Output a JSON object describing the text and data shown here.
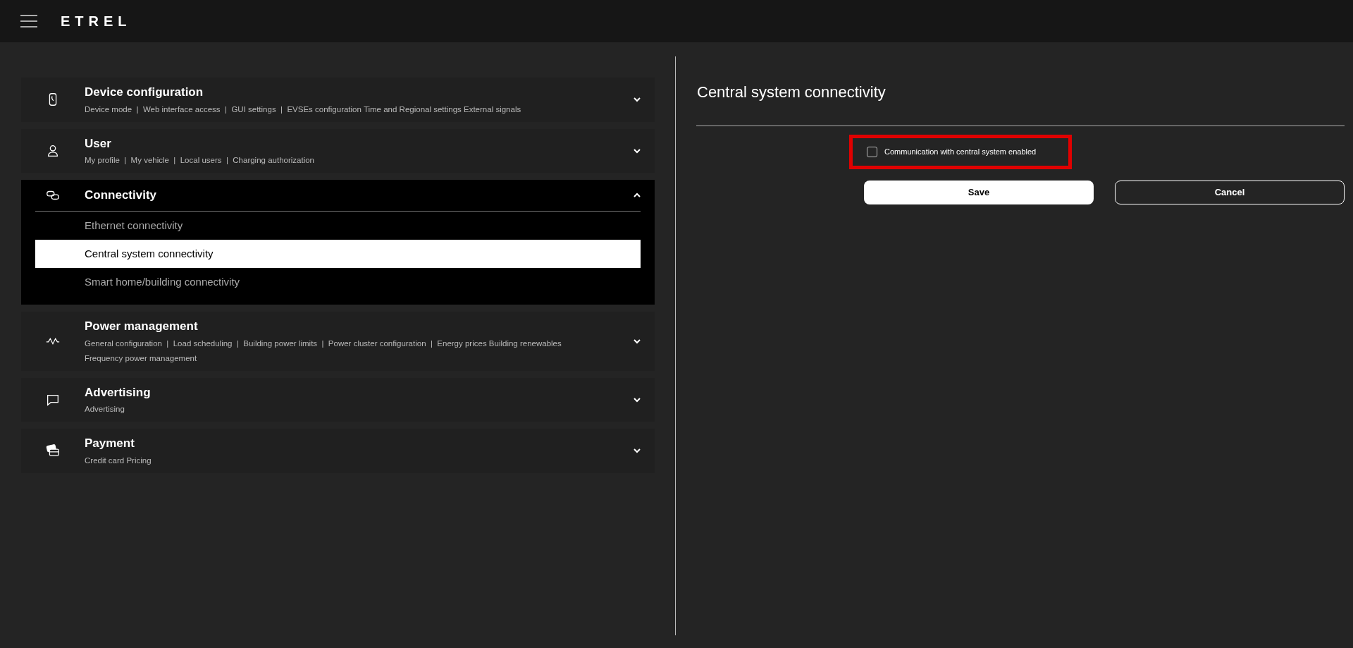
{
  "header": {
    "logo": "ETREL"
  },
  "sections": [
    {
      "title": "Device configuration",
      "expanded": false,
      "lines": [
        "Device mode  |  Web interface access  |  GUI settings  |  EVSEs configuration Time and Regional settings External signals"
      ]
    },
    {
      "title": "User",
      "expanded": false,
      "lines": [
        "My profile  |  My vehicle  |  Local users  |  Charging authorization"
      ]
    },
    {
      "title": "Connectivity",
      "expanded": true,
      "items": [
        {
          "label": "Ethernet connectivity",
          "selected": false
        },
        {
          "label": "Central system connectivity",
          "selected": true
        },
        {
          "label": "Smart home/building connectivity",
          "selected": false
        }
      ]
    },
    {
      "title": "Power management",
      "expanded": false,
      "lines": [
        "General configuration  |  Load scheduling  |  Building power limits  |  Power cluster configuration  |  Energy prices Building renewables",
        "Frequency power management"
      ]
    },
    {
      "title": "Advertising",
      "expanded": false,
      "lines": [
        "Advertising"
      ]
    },
    {
      "title": "Payment",
      "expanded": false,
      "lines": [
        "Credit card Pricing"
      ]
    }
  ],
  "panel": {
    "title": "Central system connectivity",
    "checkbox": {
      "label": "Communication with central system enabled",
      "checked": false,
      "highlighted": true
    },
    "buttons": [
      {
        "label": "Save",
        "kind": "primary"
      },
      {
        "label": "Cancel",
        "kind": "secondary"
      }
    ]
  }
}
